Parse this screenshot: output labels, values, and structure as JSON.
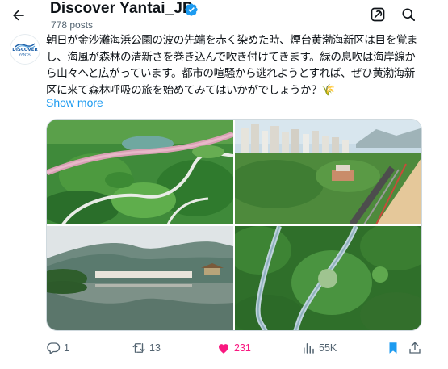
{
  "header": {
    "profile_name": "Discover Yantai_JP",
    "post_count": "778 posts",
    "avatar_line1": "DISCOVER",
    "avatar_line2": "YANTAI"
  },
  "tweet": {
    "text": "朝日が金沙灘海浜公園の波の先端を赤く染めた時、煙台黄渤海新区は目を覚まし、海風が森林の清新さを巻き込んで吹き付けてきます。緑の息吹は海岸線から山々へと広がっています。都市の喧騒から逃れようとすれば、ぜひ黄渤海新区に来て森林呼吸の旅を始めてみてはいかがでしょうか？🌾",
    "show_more": "Show more"
  },
  "actions": {
    "replies": "1",
    "reposts": "13",
    "likes": "231",
    "views": "55K"
  },
  "colors": {
    "accent": "#1d9bf0",
    "like": "#f91880",
    "muted": "#536471",
    "text": "#0f1419"
  },
  "icons": {
    "back": "arrow-left-icon",
    "verified": "verified-badge-icon",
    "grok": "grok-icon",
    "search": "search-icon",
    "reply": "reply-icon",
    "repost": "repost-icon",
    "like": "heart-icon",
    "views": "views-icon",
    "bookmark": "bookmark-icon",
    "share": "share-icon"
  }
}
